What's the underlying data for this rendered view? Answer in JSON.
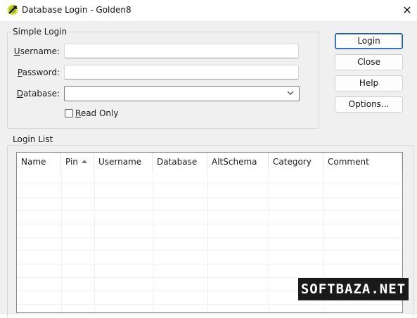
{
  "window": {
    "title": "Database Login - Golden8",
    "close_glyph": "✕"
  },
  "simple_login": {
    "group_title": "Simple Login",
    "username": {
      "label_first": "U",
      "label_rest": "sername:",
      "value": ""
    },
    "password": {
      "label_first": "P",
      "label_rest": "assword:",
      "value": ""
    },
    "database": {
      "label_first": "D",
      "label_rest": "atabase:",
      "value": ""
    },
    "read_only": {
      "label_first": "R",
      "label_rest": "ead Only",
      "checked": false
    }
  },
  "buttons": {
    "login": "Login",
    "close": "Close",
    "help": "Help",
    "options": "Options..."
  },
  "login_list": {
    "group_title": "Login List",
    "columns": [
      "Name",
      "Pin",
      "Username",
      "Database",
      "AltSchema",
      "Category",
      "Comment"
    ],
    "sorted_column": "Pin",
    "rows": []
  },
  "watermark": "SOFTBAZA.NET",
  "colors": {
    "window_bg": "#f0f0f0",
    "default_button_border": "#1f5a9e"
  }
}
